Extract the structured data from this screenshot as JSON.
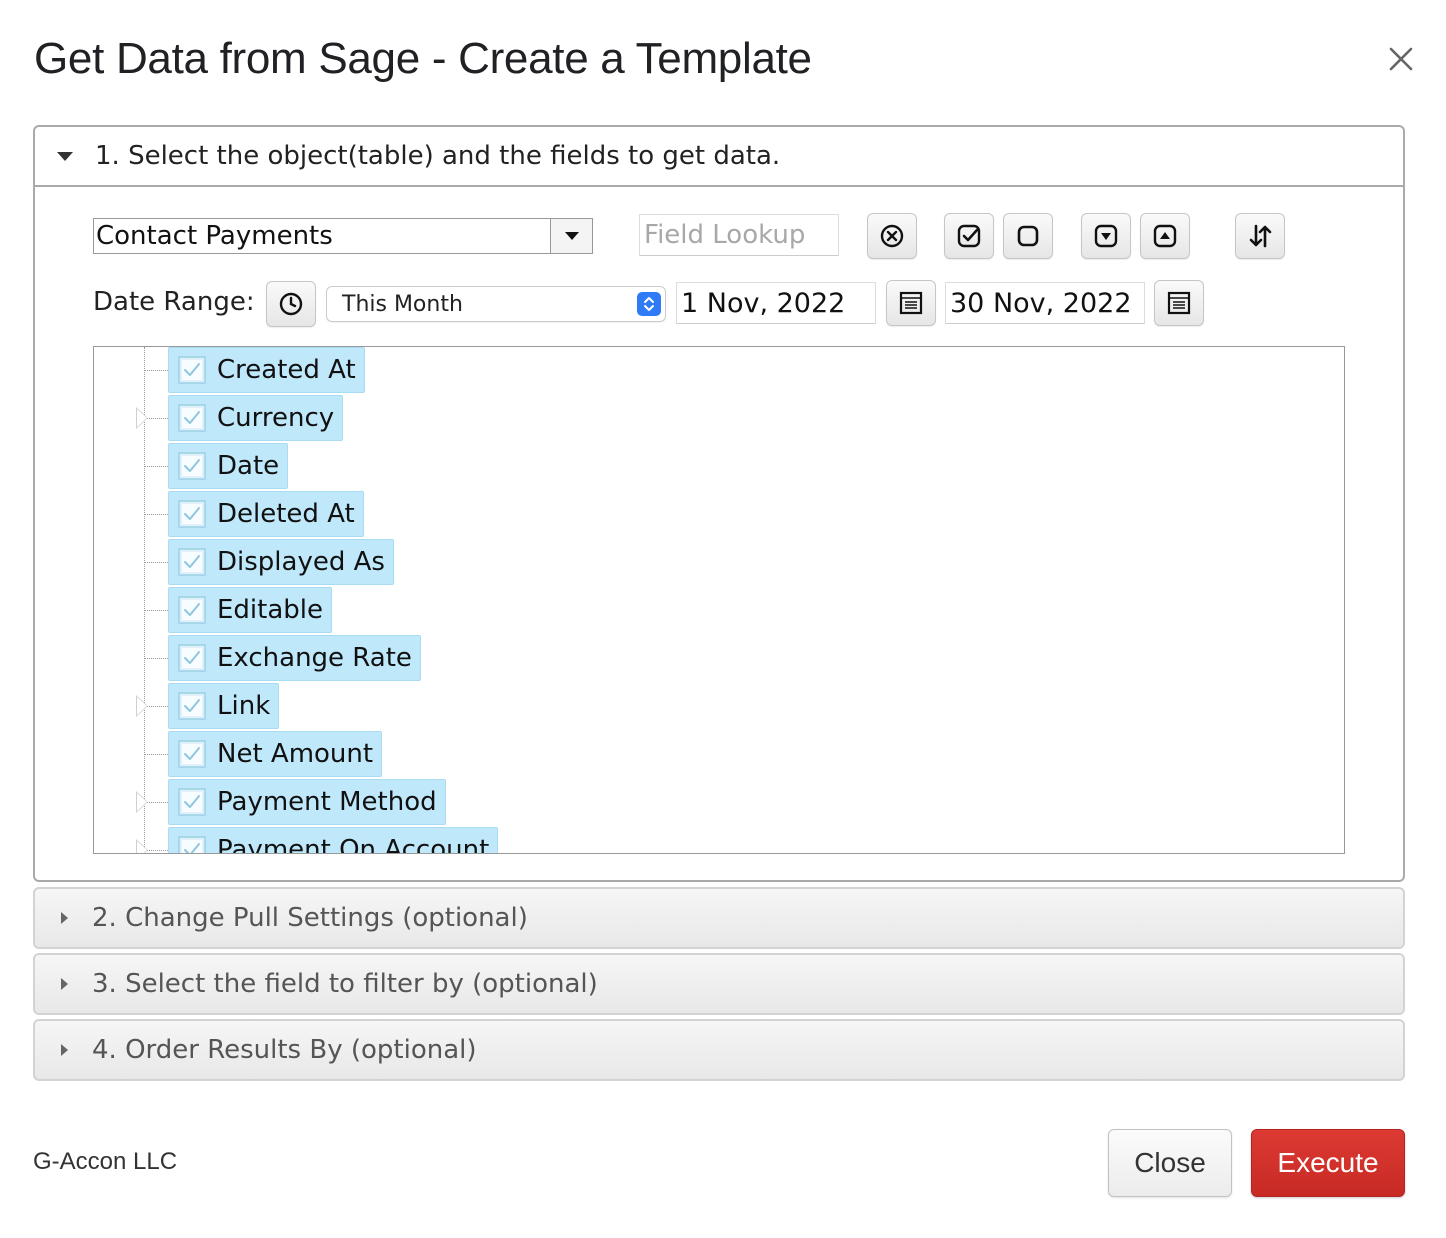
{
  "dialog": {
    "title": "Get Data from Sage - Create a Template"
  },
  "section1": {
    "header": "1. Select the object(table) and the fields to get data.",
    "object_select": {
      "value": "Contact Payments"
    },
    "field_lookup": {
      "placeholder": "Field Lookup"
    },
    "toolbar": {
      "clear_icon": "clear-circle-icon",
      "check_all_icon": "check-square-icon",
      "uncheck_all_icon": "empty-square-icon",
      "expand_icon": "expand-down-icon",
      "collapse_icon": "collapse-up-icon",
      "sort_icon": "sort-arrows-icon"
    },
    "date_range": {
      "label": "Date Range:",
      "period": "This Month",
      "from": "1 Nov, 2022",
      "to": "30 Nov, 2022"
    },
    "fields": [
      {
        "label": "Created At",
        "checked": true,
        "expandable": false
      },
      {
        "label": "Currency",
        "checked": true,
        "expandable": true
      },
      {
        "label": "Date",
        "checked": true,
        "expandable": false
      },
      {
        "label": "Deleted At",
        "checked": true,
        "expandable": false
      },
      {
        "label": "Displayed As",
        "checked": true,
        "expandable": false
      },
      {
        "label": "Editable",
        "checked": true,
        "expandable": false
      },
      {
        "label": "Exchange Rate",
        "checked": true,
        "expandable": false
      },
      {
        "label": "Link",
        "checked": true,
        "expandable": true
      },
      {
        "label": "Net Amount",
        "checked": true,
        "expandable": false
      },
      {
        "label": "Payment Method",
        "checked": true,
        "expandable": true
      },
      {
        "label": "Payment On Account",
        "checked": true,
        "expandable": true
      }
    ]
  },
  "sections": [
    {
      "label": "2. Change Pull Settings (optional)"
    },
    {
      "label": "3. Select the field to filter by (optional)"
    },
    {
      "label": "4. Order Results By (optional)"
    }
  ],
  "footer": {
    "company": "G-Accon LLC",
    "close_label": "Close",
    "execute_label": "Execute"
  },
  "colors": {
    "accent_execute": "#d2322d",
    "node_highlight": "#bfe8fb",
    "select_stepper": "#2f7bf5"
  }
}
